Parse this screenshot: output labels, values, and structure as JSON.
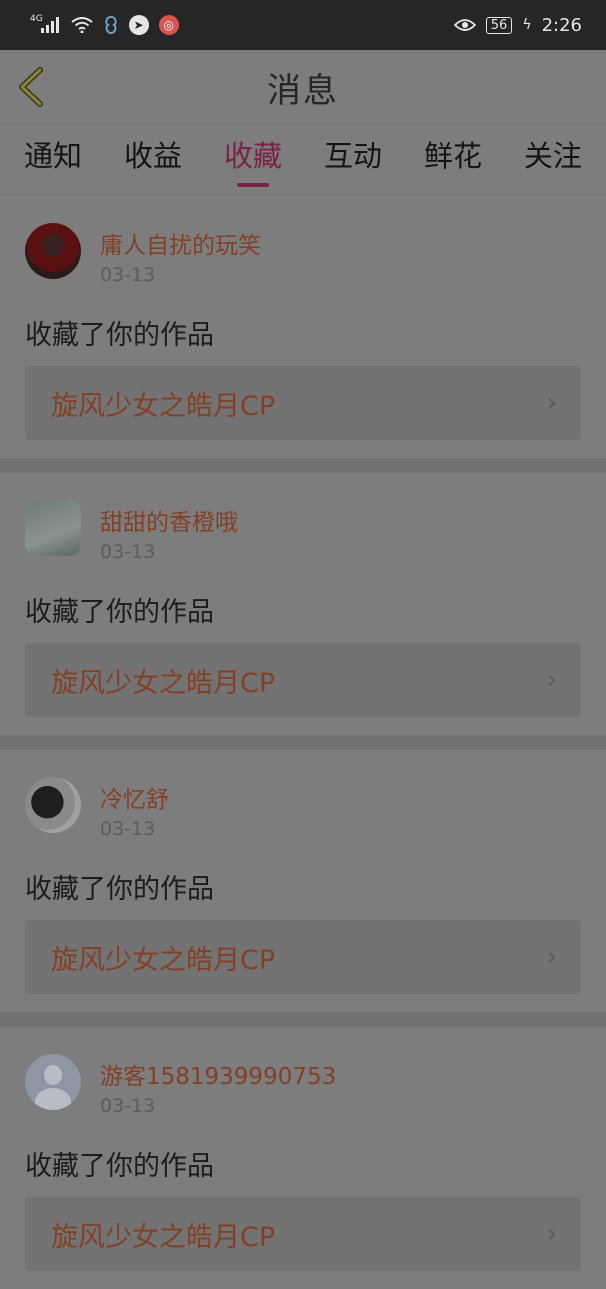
{
  "status_bar": {
    "network_label": "4G",
    "battery_level": "56",
    "time": "2:26"
  },
  "header": {
    "title": "消息"
  },
  "tabs": [
    {
      "label": "通知",
      "active": false
    },
    {
      "label": "收益",
      "active": false
    },
    {
      "label": "收藏",
      "active": true
    },
    {
      "label": "互动",
      "active": false
    },
    {
      "label": "鲜花",
      "active": false
    },
    {
      "label": "关注",
      "active": false
    }
  ],
  "messages": [
    {
      "username": "庸人自扰的玩笑",
      "date": "03-13",
      "action": "收藏了你的作品",
      "work_title": "旋风少女之皓月CP"
    },
    {
      "username": "甜甜的香橙哦",
      "date": "03-13",
      "action": "收藏了你的作品",
      "work_title": "旋风少女之皓月CP"
    },
    {
      "username": "冷忆舒",
      "date": "03-13",
      "action": "收藏了你的作品",
      "work_title": "旋风少女之皓月CP"
    },
    {
      "username": "游客1581939990753",
      "date": "03-13",
      "action": "收藏了你的作品",
      "work_title": "旋风少女之皓月CP"
    }
  ],
  "colors": {
    "accent": "#7b2347",
    "link_text": "#834026"
  }
}
